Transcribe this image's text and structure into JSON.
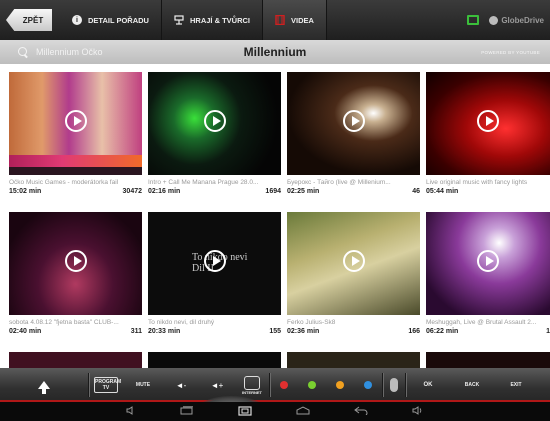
{
  "topbar": {
    "back_label": "ZPĚT",
    "tabs": [
      {
        "label": "DETAIL POŘADU",
        "icon": "info-icon"
      },
      {
        "label": "HRAJÍ & TVŮRCI",
        "icon": "cast-icon"
      },
      {
        "label": "VIDEA",
        "icon": "film-icon"
      }
    ],
    "brand": "GlobeDrive"
  },
  "search": {
    "placeholder": "Millennium Očko",
    "title": "Millennium",
    "powered_by": "POWERED BY YOUTUBE"
  },
  "videos": [
    {
      "title": "Očko Music Games - moderátorka fail",
      "duration": "15:02 min",
      "views": "30472"
    },
    {
      "title": "Intro + Call Me Manana Prague 28.0...",
      "duration": "02:16 min",
      "views": "1694"
    },
    {
      "title": "Буерокс - Тайго (live @ Millenium...",
      "duration": "02:25 min",
      "views": "46"
    },
    {
      "title": "Live original music with fancy lights",
      "duration": "05:44 min",
      "views": ""
    },
    {
      "title": "sobota 4.08.12 \"fjetna basta\" CLUB-...",
      "duration": "02:40 min",
      "views": "311"
    },
    {
      "title": "To nikdo nevi, dil druhý",
      "duration": "20:33 min",
      "views": "155"
    },
    {
      "title": "Ferko Julius-Sk8",
      "duration": "02:36 min",
      "views": "166"
    },
    {
      "title": "Meshuggah, Live @ Brutal Assault 2...",
      "duration": "06:22 min",
      "views": "1"
    }
  ],
  "thumb6_overlay": "To nikdo nevi\nDil II",
  "controls": {
    "tv_label": "PROGRAM TV",
    "mute": "MUTE",
    "vol_down": "◄-",
    "vol_up": "◄+",
    "internet": "INTERNET",
    "ok": "OK",
    "back": "BACK",
    "exit": "EXIT",
    "color_dots": [
      "#e03030",
      "#7ad030",
      "#f0a020",
      "#3090e0"
    ]
  },
  "accent_green": "#3bbf3b",
  "accent_red": "#b01818"
}
